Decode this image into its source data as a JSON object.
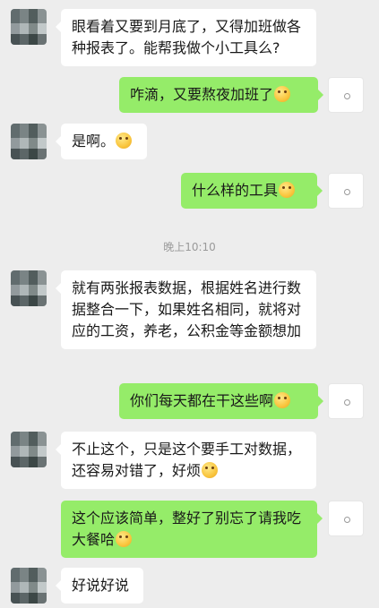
{
  "time_divider": "晚上10:10",
  "messages": [
    {
      "side": "left",
      "text": "眼看着又要到月底了，又得加班做各种报表了。能帮我做个小工具么?",
      "emoji": ""
    },
    {
      "side": "right",
      "text": "咋滴，又要熬夜加班了",
      "emoji": "thinking-emoji"
    },
    {
      "side": "left",
      "text": "是啊。",
      "emoji": "blush-emoji"
    },
    {
      "side": "right",
      "text": "什么样的工具",
      "emoji": "laughing-emoji"
    },
    {
      "side": "left",
      "text": "就有两张报表数据，根据姓名进行数据整合一下，如果姓名相同，就将对应的工资，养老，公积金等金额想加",
      "emoji": ""
    },
    {
      "side": "right",
      "text": "你们每天都在干这些啊",
      "emoji": "laughing-emoji"
    },
    {
      "side": "left",
      "text": "不止这个，只是这个要手工对数据，还容易对错了，好烦",
      "emoji": "blush-emoji"
    },
    {
      "side": "right",
      "text": "这个应该简单，整好了别忘了请我吃大餐哈",
      "emoji": "thinking-emoji"
    },
    {
      "side": "left",
      "text": "好说好说",
      "emoji": ""
    }
  ]
}
